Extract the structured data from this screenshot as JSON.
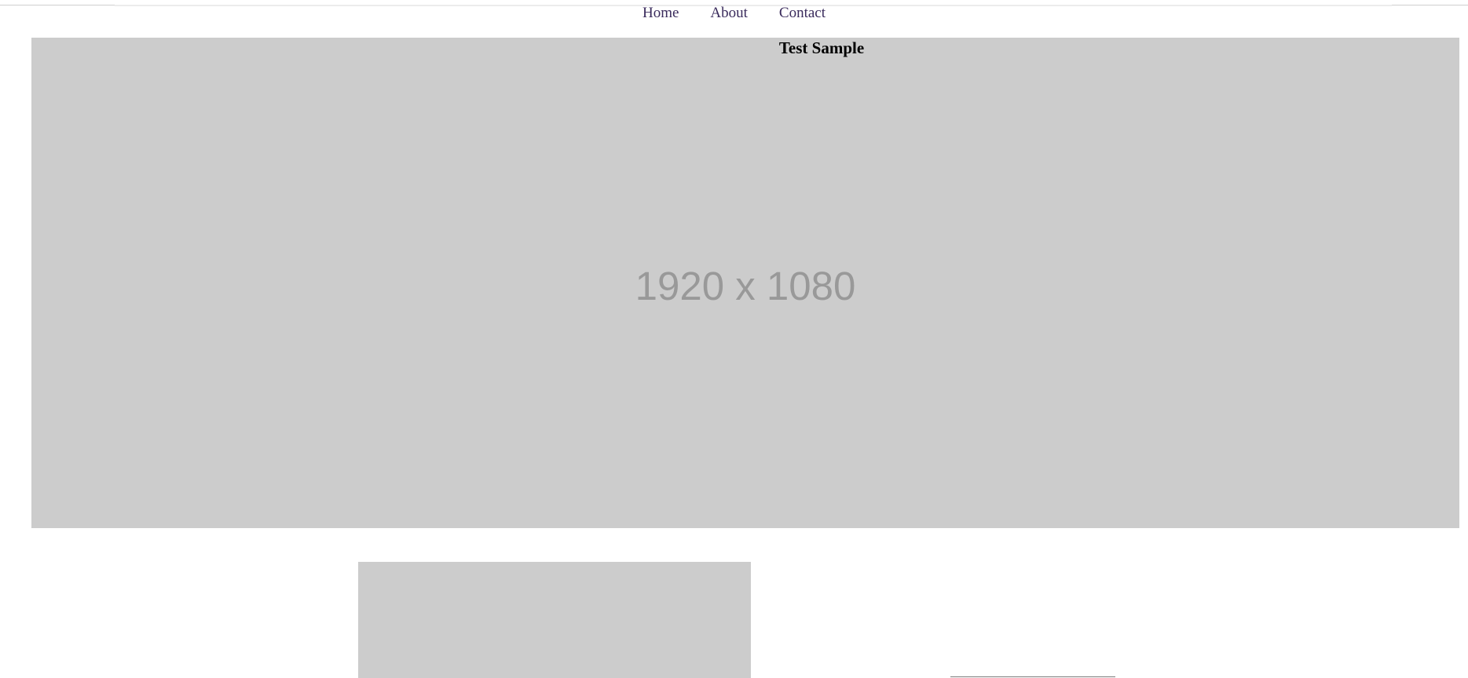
{
  "nav": {
    "items": [
      {
        "label": "Home"
      },
      {
        "label": "About"
      },
      {
        "label": "Contact"
      }
    ]
  },
  "hero": {
    "title": "Test Sample",
    "placeholder_text": "1920 x 1080"
  },
  "colors": {
    "placeholder_bg": "#cccccc",
    "placeholder_text": "#999999",
    "nav_link": "#3a2b5c"
  }
}
